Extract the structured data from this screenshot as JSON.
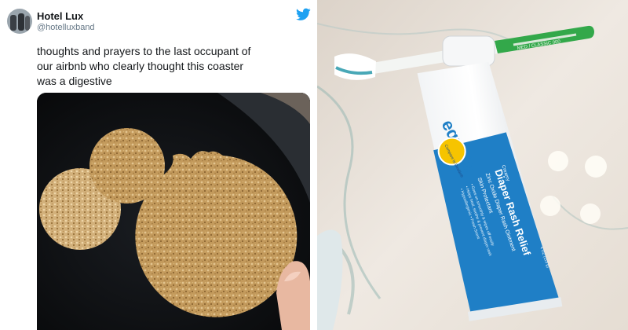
{
  "tweet": {
    "display_name": "Hotel Lux",
    "handle": "@hotelluxband",
    "text": "thoughts and prayers to the last occupant of\nour airbnb who clearly thought this coaster\nwas a digestive"
  },
  "toothbrush": {
    "label": "MED / CLASSIC 000"
  },
  "tube": {
    "brand": "equate",
    "badge": "Compare to Desitin®",
    "flavor": "Creamy",
    "title1": "Diaper Rash Relief",
    "title2": "Zinc Oxide Diaper Rash Ointment",
    "title3": "Skin Protectant",
    "bullet1": "• Goes on smoothly & wipes off easily",
    "bullet2": "• Helps heal, soothe & prevent diaper rash",
    "bullet3": "• Hypoallergenic • Fresh Scent",
    "size": "4 OZ (113 g)"
  },
  "colors": {
    "twitter_blue": "#1da1f2",
    "brand_blue": "#1f7fc6"
  }
}
